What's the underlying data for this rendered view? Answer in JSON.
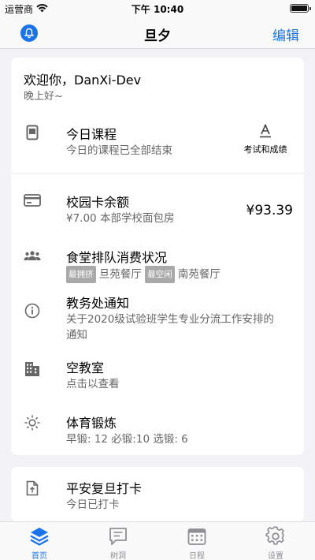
{
  "status_bar": {
    "carrier": "运营商",
    "time": "下午 10:40"
  },
  "nav": {
    "title": "旦夕",
    "edit_label": "编辑",
    "bell_icon": "bell-icon"
  },
  "greeting": {
    "title": "欢迎你，DanXi-Dev",
    "subtitle": "晚上好~"
  },
  "today_courses": {
    "title": "今日课程",
    "subtitle": "今日的课程已全部结束",
    "action_label": "考试和成绩",
    "icon": "calendar-card-icon",
    "action_icon": "text-a-icon"
  },
  "card_balance": {
    "title": "校园卡余额",
    "subtitle": "¥7.00 本部学校面包房",
    "amount": "¥93.39",
    "icon": "credit-card-icon"
  },
  "canteen": {
    "title": "食堂排队消费状况",
    "badge_busy": "最拥挤",
    "busy_name": "旦苑餐厅",
    "badge_free": "最空闲",
    "free_name": "南苑餐厅",
    "icon": "people-icon"
  },
  "notice": {
    "title": "教务处通知",
    "line1": "关于2020级试验班学生专业分流工作安排的",
    "line2": "通知",
    "icon": "info-icon"
  },
  "classroom": {
    "title": "空教室",
    "subtitle": "点击以查看",
    "icon": "building-icon"
  },
  "exercise": {
    "title": "体育锻炼",
    "subtitle": "早锻: 12 必锻:10 选锻: 6",
    "icon": "sun-icon"
  },
  "checkin": {
    "title": "平安复旦打卡",
    "subtitle": "今日已打卡",
    "icon": "file-upload-icon"
  },
  "tabs": [
    {
      "label": "首页",
      "icon": "layers-icon",
      "active": true
    },
    {
      "label": "树洞",
      "icon": "chat-icon",
      "active": false
    },
    {
      "label": "日程",
      "icon": "calendar-icon",
      "active": false
    },
    {
      "label": "设置",
      "icon": "gear-icon",
      "active": false
    }
  ],
  "colors": {
    "accent": "#1a73e8",
    "badge": "#a9a9a9",
    "background": "#f2f2f7"
  }
}
